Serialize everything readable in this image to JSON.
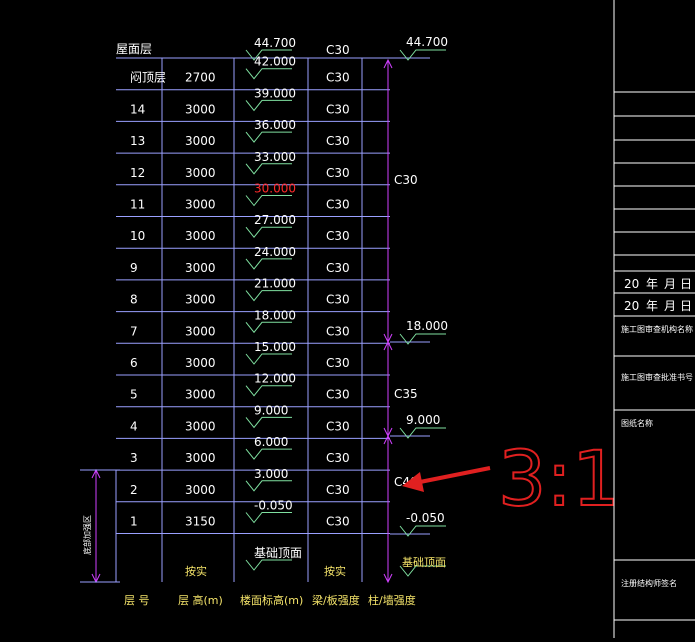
{
  "colors": {
    "background": "#000000",
    "grid": "#9aa0ff",
    "text": "#ffffff",
    "elevation_highlight": "#ff2a2a",
    "dimension": "#d040ff",
    "marker": "#7fe0a0",
    "annotation": "#e02020"
  },
  "table": {
    "top_label": "屋面层",
    "top_elevation": "44.700",
    "top_concrete": "C30",
    "rows": [
      {
        "floor": "闷顶层",
        "height": "2700",
        "elevation": "42.000",
        "concrete": "C30"
      },
      {
        "floor": "14",
        "height": "3000",
        "elevation": "39.000",
        "concrete": "C30"
      },
      {
        "floor": "13",
        "height": "3000",
        "elevation": "36.000",
        "concrete": "C30"
      },
      {
        "floor": "12",
        "height": "3000",
        "elevation": "33.000",
        "concrete": "C30"
      },
      {
        "floor": "11",
        "height": "3000",
        "elevation": "30.000",
        "concrete": "C30",
        "highlight": true
      },
      {
        "floor": "10",
        "height": "3000",
        "elevation": "27.000",
        "concrete": "C30"
      },
      {
        "floor": "9",
        "height": "3000",
        "elevation": "24.000",
        "concrete": "C30"
      },
      {
        "floor": "8",
        "height": "3000",
        "elevation": "21.000",
        "concrete": "C30"
      },
      {
        "floor": "7",
        "height": "3000",
        "elevation": "18.000",
        "concrete": "C30"
      },
      {
        "floor": "6",
        "height": "3000",
        "elevation": "15.000",
        "concrete": "C30"
      },
      {
        "floor": "5",
        "height": "3000",
        "elevation": "12.000",
        "concrete": "C30"
      },
      {
        "floor": "4",
        "height": "3000",
        "elevation": "9.000",
        "concrete": "C30"
      },
      {
        "floor": "3",
        "height": "3000",
        "elevation": "6.000",
        "concrete": "C30"
      },
      {
        "floor": "2",
        "height": "3000",
        "elevation": "3.000",
        "concrete": "C30"
      },
      {
        "floor": "1",
        "height": "3150",
        "elevation": "-0.050",
        "concrete": "C30"
      }
    ],
    "footer_row": {
      "height": "按实",
      "elevation": "基础顶面",
      "concrete": "按实"
    },
    "headers": [
      "层 号",
      "层 高(m)",
      "楼面标高(m)",
      "梁/板强度",
      "柱/墙强度"
    ],
    "embed_zone_label": "底部加强区"
  },
  "column_zones": [
    {
      "label": "C30",
      "elevation_top": "44.700",
      "elevation_bottom": "18.000"
    },
    {
      "label": "C35",
      "elevation_top": "18.000",
      "elevation_bottom": "9.000"
    },
    {
      "label": "C40",
      "elevation_top": "9.000",
      "elevation_bottom": "-0.050"
    }
  ],
  "right_marks": [
    "44.700",
    "18.000",
    "9.000",
    "-0.050"
  ],
  "right_footer": "基础顶面",
  "annotation_text": "3:1",
  "title_block": {
    "date_rows": [
      {
        "c1": "20",
        "c2": "年",
        "c3": "月",
        "c4": "日"
      },
      {
        "c1": "20",
        "c2": "年",
        "c3": "月",
        "c4": "日"
      }
    ],
    "labels": [
      "施工图审查机构名称",
      "施工图审查批准书号",
      "图纸名称",
      "注册结构师签名"
    ]
  }
}
